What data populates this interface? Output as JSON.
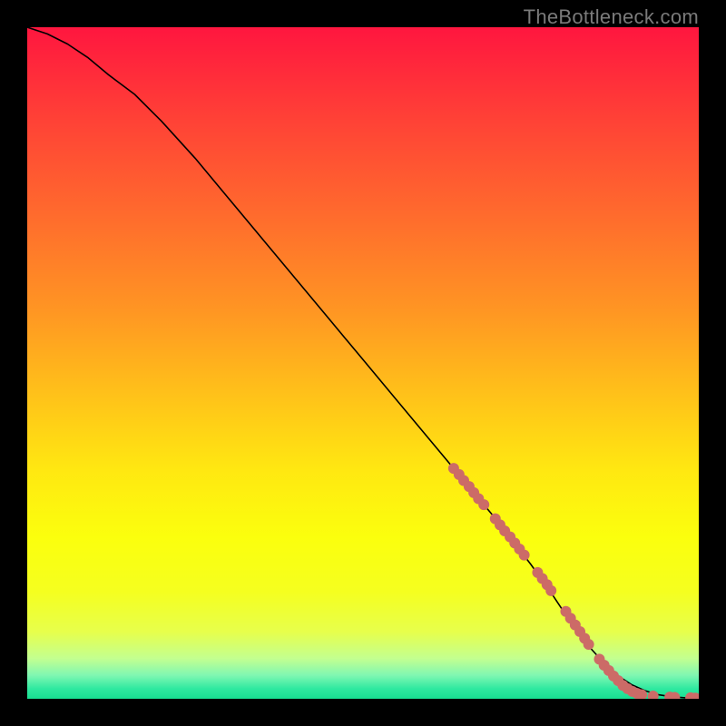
{
  "watermark": "TheBottleneck.com",
  "chart_data": {
    "type": "line",
    "title": "",
    "xlabel": "",
    "ylabel": "",
    "xlim": [
      0,
      100
    ],
    "ylim": [
      0,
      100
    ],
    "grid": false,
    "legend": false,
    "background_gradient_stops": [
      {
        "offset": 0.0,
        "color": "#ff163f"
      },
      {
        "offset": 0.14,
        "color": "#ff4236"
      },
      {
        "offset": 0.28,
        "color": "#ff6b2d"
      },
      {
        "offset": 0.42,
        "color": "#ff9523"
      },
      {
        "offset": 0.54,
        "color": "#ffbf1a"
      },
      {
        "offset": 0.66,
        "color": "#ffe811"
      },
      {
        "offset": 0.76,
        "color": "#fbff0d"
      },
      {
        "offset": 0.84,
        "color": "#f5ff1f"
      },
      {
        "offset": 0.9,
        "color": "#e7ff4b"
      },
      {
        "offset": 0.94,
        "color": "#c3ff90"
      },
      {
        "offset": 0.965,
        "color": "#80f7b2"
      },
      {
        "offset": 0.985,
        "color": "#2fe9a0"
      },
      {
        "offset": 1.0,
        "color": "#18df91"
      }
    ],
    "series": [
      {
        "name": "curve",
        "type": "line",
        "color": "#000000",
        "stroke_width": 1.6,
        "x": [
          0,
          3,
          6,
          9,
          12,
          16,
          20,
          25,
          30,
          35,
          40,
          45,
          50,
          55,
          60,
          65,
          70,
          75,
          78,
          80,
          82,
          84,
          86,
          88,
          90,
          92,
          94,
          96,
          98,
          100
        ],
        "y": [
          100,
          99,
          97.5,
          95.5,
          93,
          90,
          86,
          80.5,
          74.5,
          68.5,
          62.5,
          56.5,
          50.5,
          44.5,
          38.5,
          32.5,
          26.5,
          20,
          15.8,
          12.8,
          10,
          7.4,
          5.2,
          3.4,
          2.1,
          1.2,
          0.6,
          0.3,
          0.15,
          0.1
        ]
      },
      {
        "name": "dots",
        "type": "scatter",
        "color": "#cc6b67",
        "radius_px": 6,
        "x": [
          63.5,
          64.3,
          65.0,
          65.8,
          66.5,
          67.2,
          68.0,
          69.7,
          70.4,
          71.1,
          71.9,
          72.6,
          73.3,
          74.0,
          76.0,
          76.7,
          77.4,
          78.0,
          80.2,
          80.9,
          81.6,
          82.3,
          83.0,
          83.6,
          85.2,
          85.9,
          86.6,
          87.3,
          88.0,
          88.7,
          89.4,
          90.1,
          90.8,
          91.5,
          93.2,
          95.7,
          96.4,
          98.8,
          99.5
        ],
        "y": [
          34.3,
          33.4,
          32.5,
          31.6,
          30.7,
          29.8,
          28.9,
          26.8,
          25.9,
          25.0,
          24.1,
          23.2,
          22.3,
          21.4,
          18.8,
          17.9,
          17.0,
          16.1,
          13.0,
          12.0,
          11.0,
          10.0,
          9.0,
          8.1,
          5.9,
          5.0,
          4.2,
          3.4,
          2.7,
          2.0,
          1.5,
          1.1,
          0.8,
          0.6,
          0.4,
          0.25,
          0.2,
          0.15,
          0.1
        ]
      }
    ]
  }
}
